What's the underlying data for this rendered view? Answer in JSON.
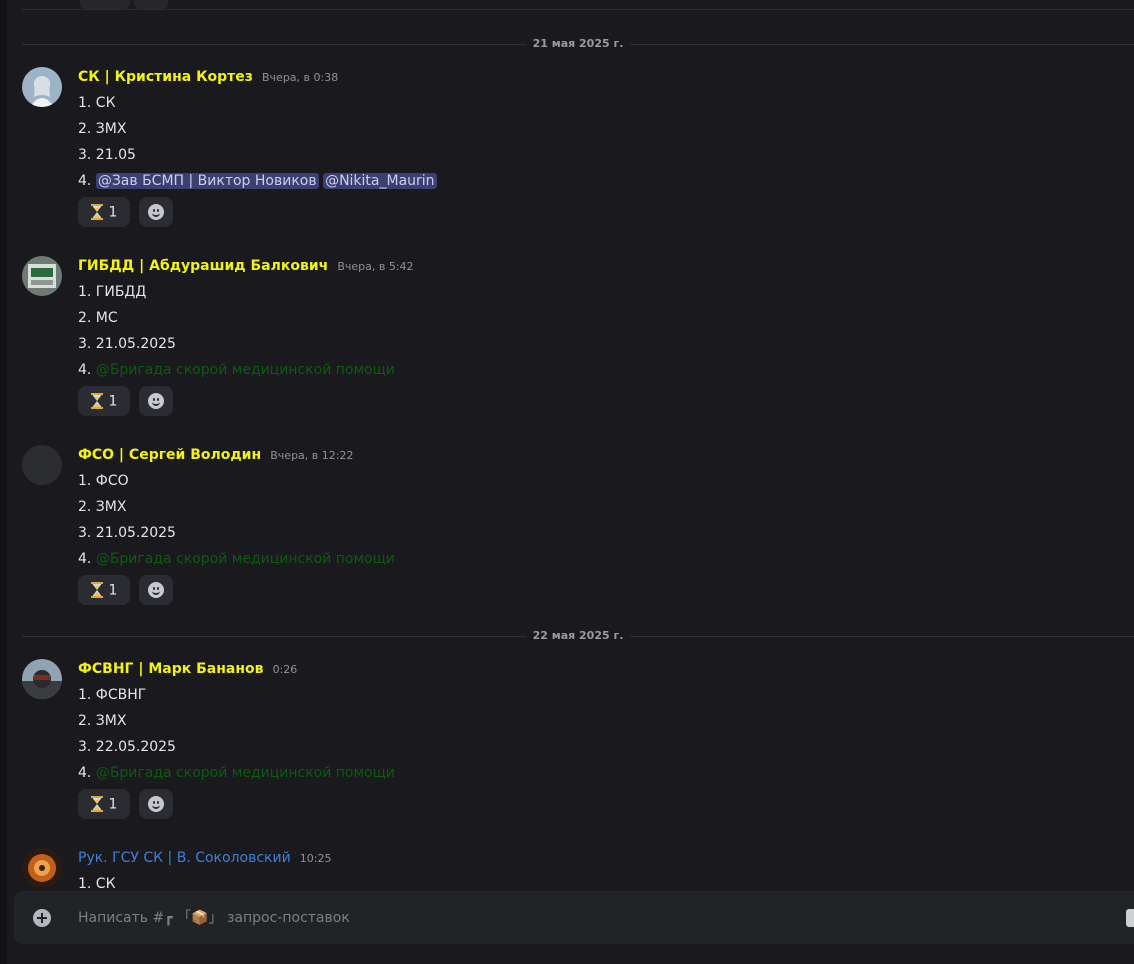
{
  "dividers": [
    "21 мая 2025 г.",
    "22 мая 2025 г."
  ],
  "messages": [
    {
      "author": "СК | Кристина Кортез",
      "timestamp": "Вчера, в 0:38",
      "lines": [
        "1. СК",
        "2. ЗМХ",
        "3. 21.05",
        "4. "
      ],
      "mentions": [
        "@Зав БСМП | Виктор Новиков",
        "@Nikita_Maurin"
      ],
      "reaction": {
        "emoji": "hourglass",
        "count": "1"
      }
    },
    {
      "author": "ГИБДД | Абдурашид Балкович",
      "timestamp": "Вчера, в 5:42",
      "lines": [
        "1. ГИБДД",
        "2. МС",
        "3. 21.05.2025",
        "4. "
      ],
      "mentions": [
        "@Бригада скорой медицинской помощи"
      ],
      "reaction": {
        "emoji": "hourglass",
        "count": "1"
      }
    },
    {
      "author": "ФСО | Сергей Володин",
      "timestamp": "Вчера, в 12:22",
      "lines": [
        "1. ФСО",
        "2. ЗМХ",
        "3. 21.05.2025",
        "4. "
      ],
      "mentions": [
        "@Бригада скорой медицинской помощи"
      ],
      "reaction": {
        "emoji": "hourglass",
        "count": "1"
      }
    },
    {
      "author": "ФСВНГ | Марк Бананов",
      "timestamp": "0:26",
      "lines": [
        "1. ФСВНГ",
        "2. ЗМХ",
        "3. 22.05.2025",
        "4. "
      ],
      "mentions": [
        "@Бригада скорой медицинской помощи"
      ],
      "reaction": {
        "emoji": "hourglass",
        "count": "1"
      }
    },
    {
      "author": "Рук. ГСУ СК | В. Соколовский",
      "timestamp": "10:25",
      "lines": [
        "1. СК"
      ]
    }
  ],
  "composer": {
    "placeholder": "Написать #┏ 「📦」 запрос-поставок"
  },
  "colors": {
    "background": "#1a1a1e",
    "author_yellow": "#f3f312",
    "author_blue": "#3e7fd6",
    "user_mention_bg": "#3b4070",
    "role_mention": "#0e5a10"
  },
  "icons": [
    "hourglass-icon",
    "add-reaction-icon",
    "add-attachment-icon",
    "gift-icon"
  ]
}
